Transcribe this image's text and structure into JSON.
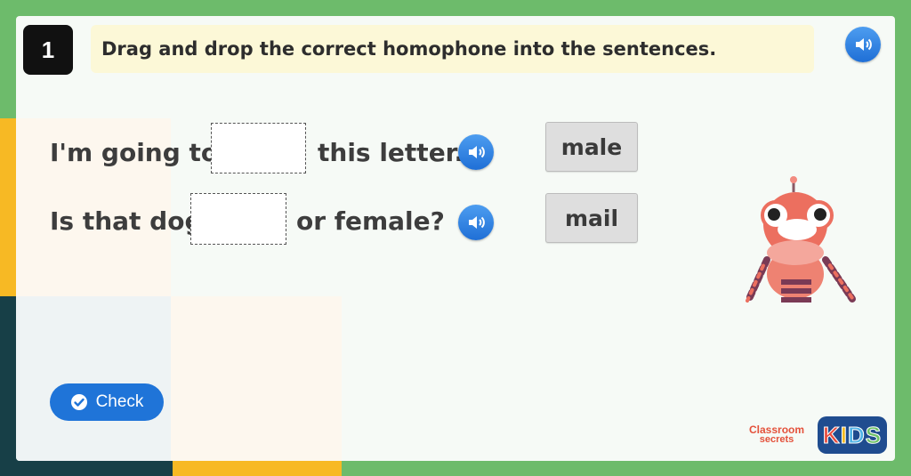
{
  "question": {
    "number": "1",
    "instruction": "Drag and drop the correct homophone into the sentences."
  },
  "sentences": [
    {
      "before": "I'm going to",
      "after": "this letter."
    },
    {
      "before": "Is that dog",
      "after": "or female?"
    }
  ],
  "word_tiles": [
    "male",
    "mail"
  ],
  "buttons": {
    "check_label": "Check"
  },
  "branding": {
    "logo_line1": "Classroom",
    "logo_line2": "secrets",
    "kids": [
      "K",
      "I",
      "D",
      "S"
    ],
    "kids_colors": [
      "#e84a3c",
      "#f6b91f",
      "#4fb3e6",
      "#6dc067"
    ]
  },
  "icons": {
    "audio": "speaker-icon",
    "check": "check-circle-icon"
  },
  "colors": {
    "accent": "#1f74d8",
    "background": "#6dbb6b",
    "instruction_bg": "#fcf8d7"
  }
}
